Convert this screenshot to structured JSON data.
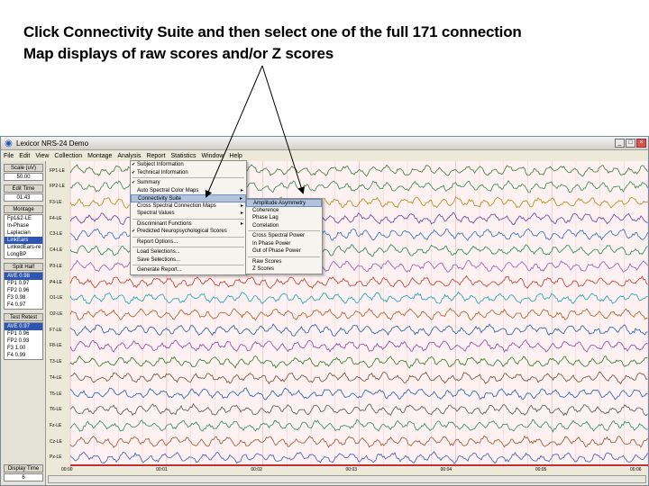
{
  "caption": {
    "line1": "Click Connectivity Suite and then select one of the full 171 connection",
    "line2": "Map displays of raw scores and/or Z scores"
  },
  "window": {
    "title": "Lexicor NRS-24 Demo",
    "icon": "brain-icon",
    "buttons": {
      "minimize": "_",
      "maximize": "□",
      "close": "×"
    }
  },
  "menubar": [
    "File",
    "Edit",
    "View",
    "Collection",
    "Montage",
    "Analysis",
    "Report",
    "Statistics",
    "Window",
    "Help"
  ],
  "left_panel": {
    "scale_label": "Scale (uV)",
    "scale_value": "50.00",
    "edit_time_label": "Edit Time",
    "edit_time_value": "01:43",
    "montage_label": "Montage",
    "montage_options": [
      "Fp1&2-LE",
      "In-Phase",
      "Laplacian",
      "LinkEars",
      "LinkedEars-re",
      "LongBP"
    ],
    "montage_selected_index": 3,
    "split_half_label": "Split Half",
    "split_half_values": [
      "AVE 0.98",
      "FP1 0.97",
      "FP2 0.96",
      "F3 0.98",
      "F4 0.97"
    ],
    "test_retest_label": "Test Retest",
    "test_retest_values": [
      "AVE 0.97",
      "FP1 0.96",
      "FP2 0.93",
      "F3 1.00",
      "F4 0.99"
    ],
    "display_time_label": "Display Time",
    "display_time_value": "6"
  },
  "channels": [
    "FP1-LE",
    "FP2-LE",
    "F3-LE",
    "F4-LE",
    "C3-LE",
    "C4-LE",
    "P3-LE",
    "P4-LE",
    "O1-LE",
    "O2-LE",
    "F7-LE",
    "F8-LE",
    "T3-LE",
    "T4-LE",
    "T5-LE",
    "T6-LE",
    "Fz-LE",
    "Cz-LE",
    "Pz-LE"
  ],
  "channel_colors": [
    "#3a7a3a",
    "#2e8b57",
    "#b8860b",
    "#6a3d9a",
    "#2a6fbf",
    "#1f8a4c",
    "#9b59b6",
    "#c0392b",
    "#17a2b8",
    "#b35a1f",
    "#1e5fa8",
    "#8e44ad",
    "#2c7a2c",
    "#7a4a2a",
    "#2060b0",
    "#555555",
    "#2a8a6a",
    "#a0522d",
    "#3b5bbd"
  ],
  "time_ticks": [
    "00:00",
    "00:01",
    "00:02",
    "00:03",
    "00:04",
    "00:05",
    "00:06"
  ],
  "report_menu": {
    "items": [
      {
        "label": "Subject Information",
        "check": true,
        "sub": false,
        "sep_after": false
      },
      {
        "label": "Technical Information",
        "check": true,
        "sub": false,
        "sep_after": true
      },
      {
        "label": "Summary",
        "check": true,
        "sub": false,
        "sep_after": false
      },
      {
        "label": "Auto Spectral Color Maps",
        "check": false,
        "sub": true,
        "sep_after": false
      },
      {
        "label": "Connectivity Suite",
        "check": false,
        "sub": true,
        "sep_after": false,
        "highlight": true
      },
      {
        "label": "Cross Spectral Connection Maps",
        "check": false,
        "sub": true,
        "sep_after": false
      },
      {
        "label": "Spectral Values",
        "check": false,
        "sub": true,
        "sep_after": true
      },
      {
        "label": "Discriminant Functions",
        "check": false,
        "sub": true,
        "sep_after": false
      },
      {
        "label": "Predicted Neuropsychological Scores",
        "check": true,
        "sub": false,
        "sep_after": true
      },
      {
        "label": "Report Options...",
        "check": false,
        "sub": false,
        "sep_after": true
      },
      {
        "label": "Load Selections...",
        "check": false,
        "sub": false,
        "sep_after": false
      },
      {
        "label": "Save Selections...",
        "check": false,
        "sub": false,
        "sep_after": true
      },
      {
        "label": "Generate Report...",
        "check": false,
        "sub": false,
        "sep_after": false
      }
    ]
  },
  "connectivity_submenu": {
    "items": [
      {
        "label": "Amplitude Asymmetry",
        "highlight": true,
        "sep_after": false
      },
      {
        "label": "Coherence",
        "sep_after": false
      },
      {
        "label": "Phase Lag",
        "sep_after": false
      },
      {
        "label": "Correlation",
        "sep_after": true
      },
      {
        "label": "Cross Spectral Power",
        "sep_after": false
      },
      {
        "label": "In Phase Power",
        "sep_after": false
      },
      {
        "label": "Out of Phase Power",
        "sep_after": true
      },
      {
        "label": "Raw Scores",
        "sep_after": false
      },
      {
        "label": "Z Scores",
        "sep_after": false
      }
    ]
  }
}
